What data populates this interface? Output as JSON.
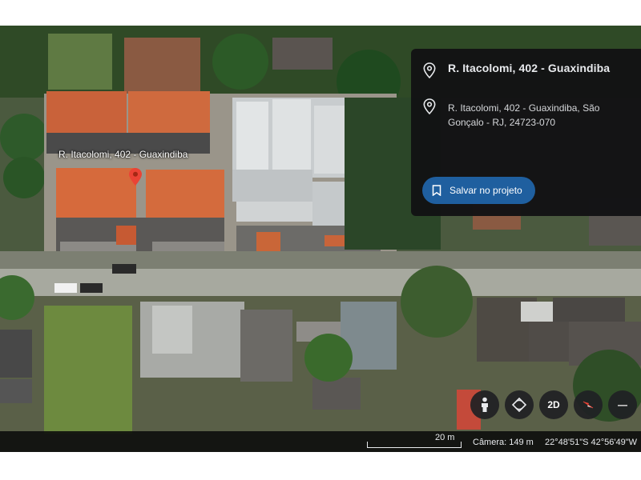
{
  "map": {
    "place_label": "R. Itacolomi, 402 - Guaxindiba"
  },
  "info_panel": {
    "title": "R. Itacolomi, 402 - Guaxindiba",
    "address": "R. Itacolomi, 402 - Guaxindiba, São Gonçalo - RJ, 24723-070",
    "save_button_label": "Salvar no projeto"
  },
  "controls": {
    "pegman_icon": "pegman-icon",
    "rotate_icon": "rotate-icon",
    "view_mode_label": "2D",
    "compass_icon": "compass-icon",
    "zoom_out_label": "—"
  },
  "status_bar": {
    "scale_label": "20 m",
    "camera_label": "Câmera: 149 m",
    "coordinates": "22°48'51\"S 42°56'49\"W"
  },
  "colors": {
    "panel_bg": "#121214",
    "button_blue": "#1f5f9f",
    "pin_red": "#ea4335",
    "roof_orange": "#d9663a"
  }
}
